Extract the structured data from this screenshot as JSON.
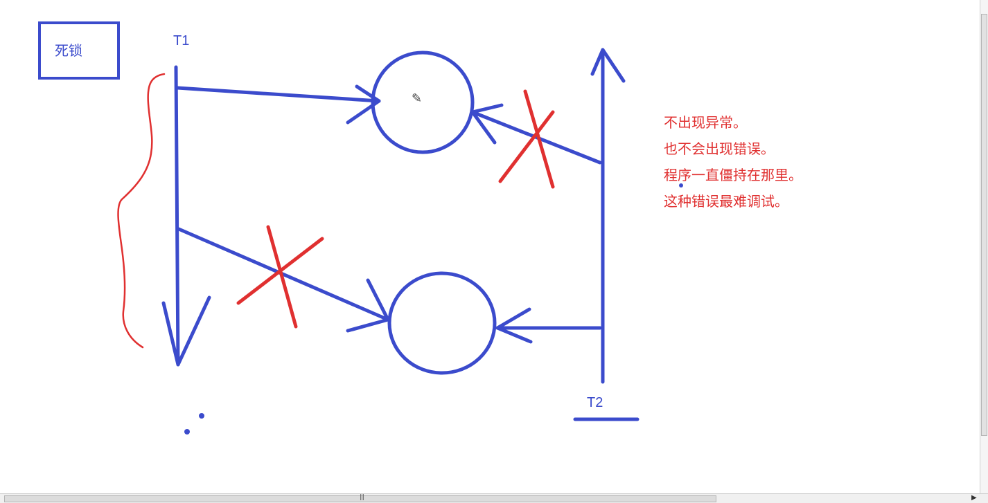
{
  "title": "死锁",
  "labels": {
    "thread1": "T1",
    "thread2": "T2"
  },
  "notes": [
    "不出现异常。",
    "也不会出现错误。",
    "程序一直僵持在那里。",
    "这种错误最难调试。"
  ],
  "colors": {
    "diagram": "#3b4bcc",
    "annotation": "#e03030",
    "note_text": "#e03030"
  },
  "icons": {
    "cursor": "pencil-icon"
  }
}
